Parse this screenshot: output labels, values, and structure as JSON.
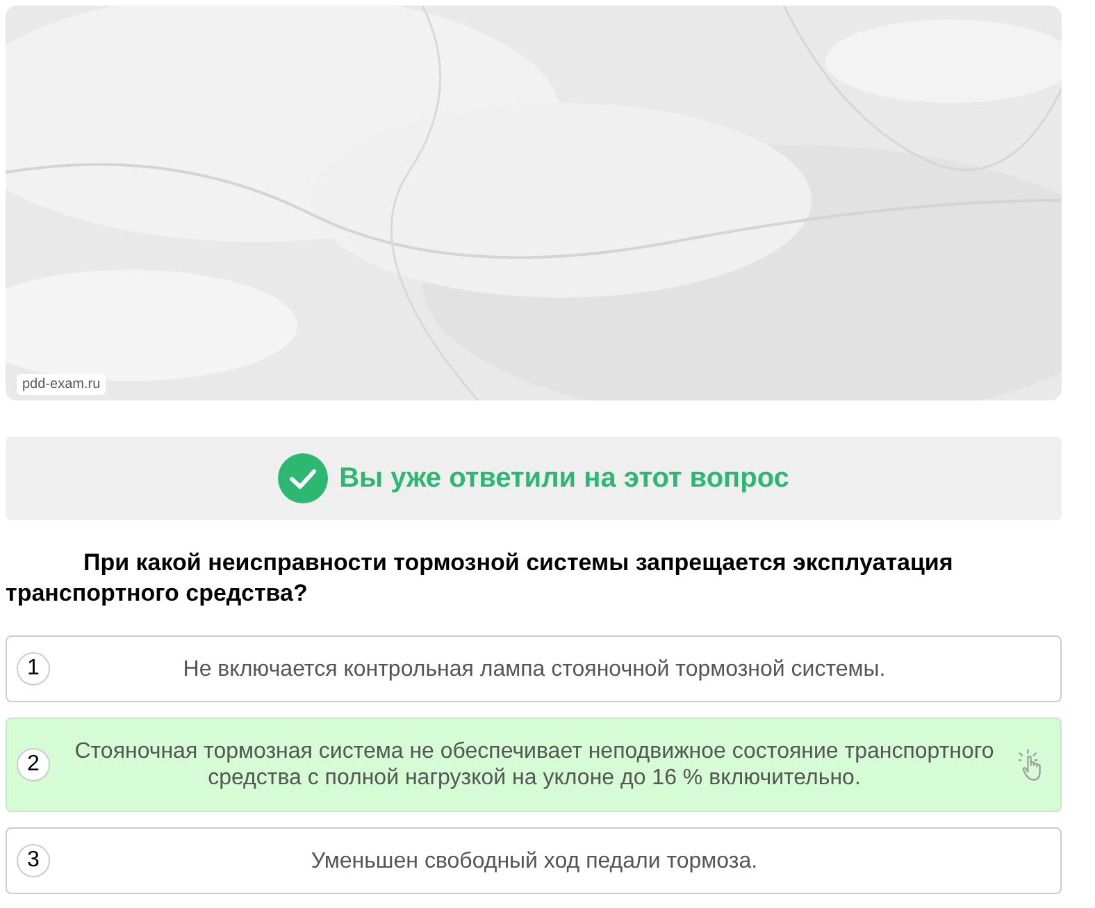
{
  "image": {
    "caption": "pdd-exam.ru"
  },
  "status": {
    "answered": true,
    "text": "Вы уже ответили на этот вопрос"
  },
  "question": "При какой неисправности тормозной системы запрещается эксплуатация транспортного средства?",
  "answers": [
    {
      "number": "1",
      "text": "Не включается контрольная лампа стояночной тормозной системы.",
      "correct": false
    },
    {
      "number": "2",
      "text": "Стояночная тормозная система не обеспечивает неподвижное состояние транспортного средства с полной нагрузкой на уклоне до 16 % включительно.",
      "correct": true
    },
    {
      "number": "3",
      "text": "Уменьшен свободный ход педали тормоза.",
      "correct": false
    }
  ]
}
